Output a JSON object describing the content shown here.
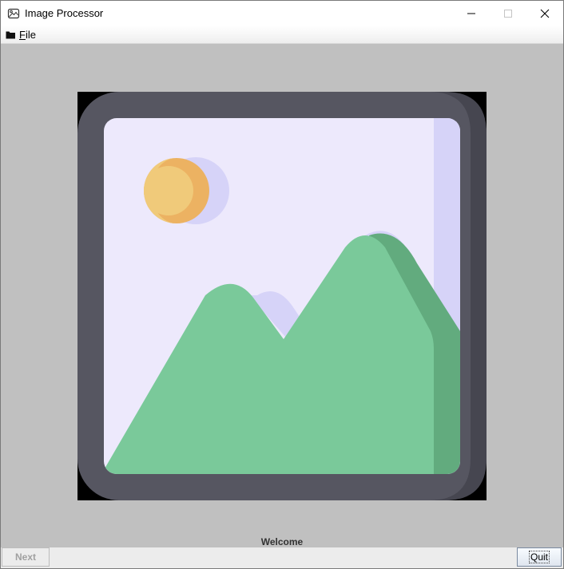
{
  "window": {
    "title": "Image Processor",
    "app_icon": "image-icon",
    "controls": [
      "minimize-icon",
      "maximize-icon",
      "close-icon"
    ]
  },
  "menu": {
    "items": [
      {
        "label": "File",
        "icon": "folder-icon"
      }
    ]
  },
  "main": {
    "image_icon": "landscape-picture-icon",
    "status_text": "Welcome"
  },
  "footer": {
    "next_label": "Next",
    "next_enabled": false,
    "quit_label": "Quit"
  },
  "colors": {
    "background": "#c0c0c0",
    "frame": "#565661",
    "frame_shadow": "#464650",
    "canvas": "#ede9fc",
    "canvas_shadow": "#d6d3f8",
    "sun": "#f0ca7a",
    "sun_shadow": "#ecb262",
    "mountain": "#7ac99a",
    "mountain_shadow": "#62ab7e"
  }
}
